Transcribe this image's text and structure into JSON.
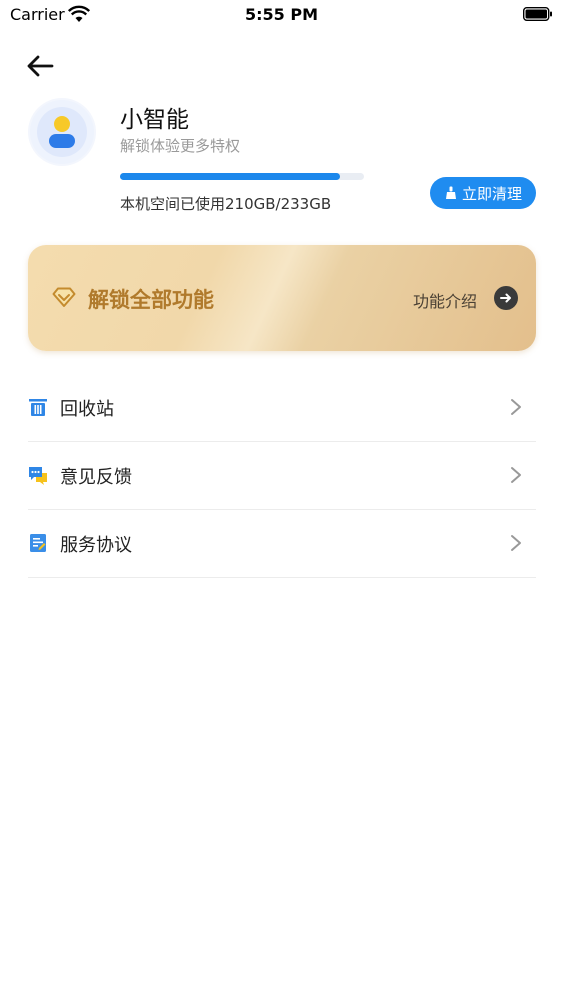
{
  "status_bar": {
    "carrier": "Carrier",
    "time": "5:55 PM"
  },
  "profile": {
    "name": "小智能",
    "subtitle": "解锁体验更多特权",
    "storage_text": "本机空间已使用210GB/233GB",
    "storage_used_gb": 210,
    "storage_total_gb": 233,
    "clean_button": "立即清理"
  },
  "unlock": {
    "title": "解锁全部功能",
    "intro": "功能介绍"
  },
  "menu": [
    {
      "label": "回收站",
      "icon": "trash-icon"
    },
    {
      "label": "意见反馈",
      "icon": "feedback-icon"
    },
    {
      "label": "服务协议",
      "icon": "agreement-icon"
    }
  ],
  "colors": {
    "accent": "#1f8cf0",
    "gold_text": "#b07a2c",
    "progress_track": "#e9edf3"
  }
}
